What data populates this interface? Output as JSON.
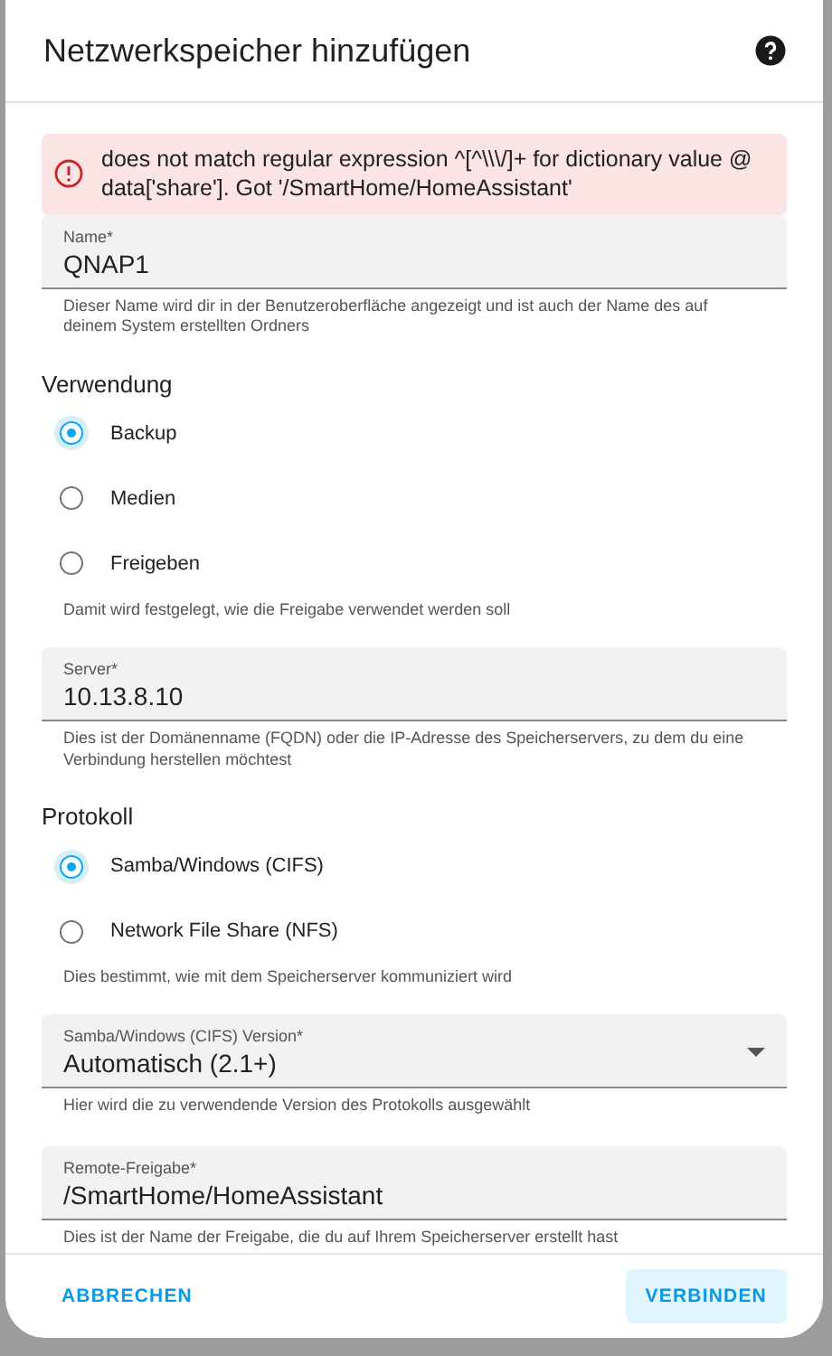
{
  "dialog": {
    "title": "Netzwerkspeicher hinzufügen"
  },
  "error": "does not match regular expression ^[^\\\\\\/]+ for dictionary value @ data['share']. Got '/SmartHome/HomeAssistant'",
  "sections": [
    {
      "kind": "field",
      "label": "Name*",
      "value": "QNAP1",
      "helper": "Dieser Name wird dir in der Benutzeroberfläche angezeigt und ist auch der Name des auf deinem System erstellten Ordners"
    },
    {
      "kind": "radios",
      "title": "Verwendung",
      "options": [
        {
          "label": "Backup",
          "selected": true
        },
        {
          "label": "Medien",
          "selected": false
        },
        {
          "label": "Freigeben",
          "selected": false
        }
      ],
      "helper": "Damit wird festgelegt, wie die Freigabe verwendet werden soll"
    },
    {
      "kind": "field",
      "label": "Server*",
      "value": "10.13.8.10",
      "helper": "Dies ist der Domänenname (FQDN) oder die IP-Adresse des Speicherservers, zu dem du eine Verbindung herstellen möchtest"
    },
    {
      "kind": "radios",
      "title": "Protokoll",
      "options": [
        {
          "label": "Samba/Windows (CIFS)",
          "selected": true
        },
        {
          "label": "Network File Share (NFS)",
          "selected": false
        }
      ],
      "helper": "Dies bestimmt, wie mit dem Speicherserver kommuniziert wird"
    },
    {
      "kind": "select",
      "label": "Samba/Windows (CIFS) Version*",
      "value": "Automatisch (2.1+)",
      "helper": "Hier wird die zu verwendende Version des Protokolls ausgewählt"
    },
    {
      "kind": "field",
      "label": "Remote-Freigabe*",
      "value": "/SmartHome/HomeAssistant",
      "helper": "Dies ist der Name der Freigabe, die du auf Ihrem Speicherserver erstellt hast"
    }
  ],
  "buttons": [
    {
      "label": "ABBRECHEN",
      "kind": "text"
    },
    {
      "label": "VERBINDEN",
      "kind": "tonal"
    }
  ]
}
